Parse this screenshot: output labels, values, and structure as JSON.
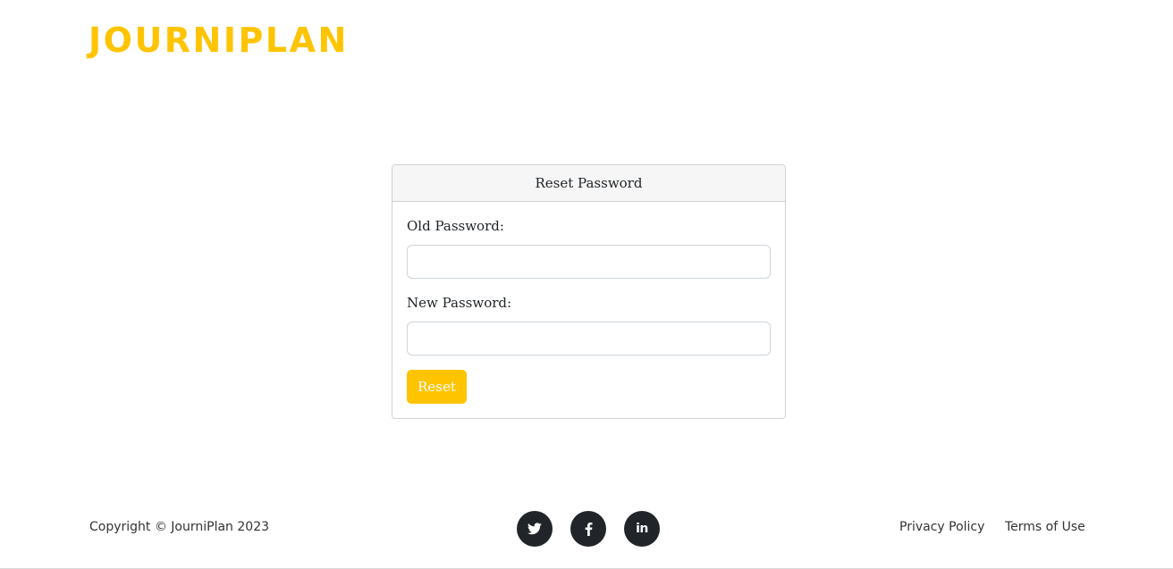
{
  "header": {
    "brand": "JOURNIPLAN"
  },
  "reset_card": {
    "title": "Reset Password",
    "old_password_label": "Old Password:",
    "old_password_value": "",
    "new_password_label": "New Password:",
    "new_password_value": "",
    "submit_label": "Reset"
  },
  "footer": {
    "copyright": "Copyright © JourniPlan 2023",
    "social": [
      {
        "name": "twitter",
        "icon": "twitter-icon"
      },
      {
        "name": "facebook",
        "icon": "facebook-icon"
      },
      {
        "name": "linkedin",
        "icon": "linkedin-icon",
        "glyph": "in"
      }
    ],
    "links": {
      "privacy": "Privacy Policy",
      "terms": "Terms of Use"
    }
  },
  "colors": {
    "brand_accent": "#ffc400",
    "social_bg": "#212529",
    "card_header_bg": "#f6f6f6"
  }
}
